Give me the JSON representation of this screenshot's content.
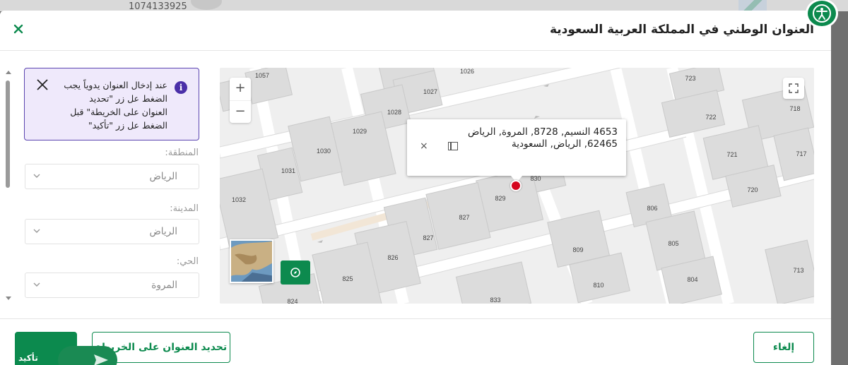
{
  "background": {
    "number": "1074133925"
  },
  "dialog": {
    "title": "العنوان الوطني في المملكة العربية السعودية",
    "close_icon": "close-icon"
  },
  "notice": {
    "text": "عند إدخال العنوان يدوياً يجب الضغط عل زر \"تحديد العنوان على الخريطة\" قبل الضغط عل زر \"تأكيد\"",
    "info_icon": "i"
  },
  "fields": {
    "region_label": "المنطقة:",
    "region_value": "الرياض",
    "city_label": "المدينة:",
    "city_value": "الرياض",
    "district_label": "الحي:",
    "district_value": "المروة"
  },
  "map": {
    "zoom_in": "+",
    "zoom_out": "−",
    "popup_address": "4653 النسيم, 8728, المروة, الرياض 62465, الرياض, السعودية",
    "popup_close": "×",
    "parcels": [
      "1057",
      "1026",
      "1027",
      "1028",
      "1029",
      "1030",
      "1031",
      "1032",
      "723",
      "722",
      "718",
      "721",
      "717",
      "720",
      "806",
      "805",
      "809",
      "810",
      "804",
      "713",
      "830",
      "829",
      "827",
      "826",
      "825",
      "824",
      "833"
    ]
  },
  "footer": {
    "cancel_label": "إلغاء",
    "set_address_label": "تحديد العنوان على الخريطة",
    "confirm_label": "تأكيد"
  },
  "colors": {
    "brand_green": "#0c8a4e",
    "notice_bg": "#efe9fb",
    "notice_border": "#5b45b0",
    "pin_red": "#d5061e"
  }
}
